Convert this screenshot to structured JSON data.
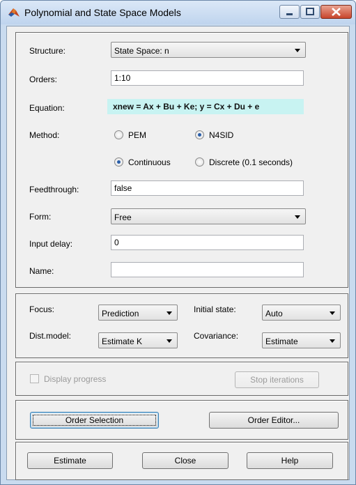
{
  "window": {
    "title": "Polynomial and State Space Models",
    "title_icon": "matlab-icon"
  },
  "model": {
    "structure_label": "Structure:",
    "structure_value": "State Space: n",
    "orders_label": "Orders:",
    "orders_value": "1:10",
    "equation_label": "Equation:",
    "equation_value": "xnew = Ax + Bu + Ke; y = Cx + Du + e",
    "method_label": "Method:",
    "method_options": [
      "PEM",
      "N4SID"
    ],
    "method_selected": "N4SID",
    "domain_options": [
      "Continuous",
      "Discrete (0.1 seconds)"
    ],
    "domain_selected": "Continuous",
    "feedthrough_label": "Feedthrough:",
    "feedthrough_value": "false",
    "form_label": "Form:",
    "form_value": "Free",
    "input_delay_label": "Input delay:",
    "input_delay_value": "0",
    "name_label": "Name:",
    "name_value": ""
  },
  "options": {
    "focus_label": "Focus:",
    "focus_value": "Prediction",
    "initial_state_label": "Initial state:",
    "initial_state_value": "Auto",
    "dist_model_label": "Dist.model:",
    "dist_model_value": "Estimate K",
    "covariance_label": "Covariance:",
    "covariance_value": "Estimate"
  },
  "progress": {
    "display_progress_label": "Display progress",
    "display_progress_checked": false,
    "stop_iterations_label": "Stop iterations"
  },
  "order": {
    "order_selection_label": "Order Selection",
    "order_editor_label": "Order Editor..."
  },
  "actions": {
    "estimate_label": "Estimate",
    "close_label": "Close",
    "help_label": "Help"
  },
  "colors": {
    "equation_background": "#c8f3f2",
    "radio_dot": "#2a5ea8",
    "titlebar": "#bfd4ee"
  }
}
